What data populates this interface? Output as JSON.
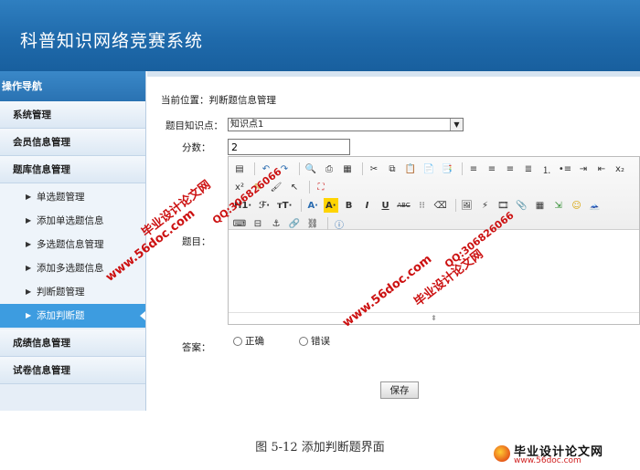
{
  "app": {
    "title": "科普知识网络竞赛系统"
  },
  "sidebar": {
    "header": "操作导航",
    "categories": [
      "系统管理",
      "会员信息管理",
      "题库信息管理"
    ],
    "items": [
      "单选题管理",
      "添加单选题信息",
      "多选题信息管理",
      "添加多选题信息",
      "判断题管理",
      "添加判断题"
    ],
    "active_item": "添加判断题",
    "bottom_categories": [
      "成绩信息管理",
      "试卷信息管理"
    ]
  },
  "main": {
    "breadcrumb": "当前位置：判断题信息管理",
    "fields": {
      "knowledge_label": "题目知识点：",
      "knowledge_value": "知识点1",
      "score_label": "分数：",
      "score_value": "2",
      "question_label": "题目：",
      "answer_label": "答案：",
      "answer_options": [
        "正确",
        "错误"
      ]
    },
    "save_label": "保存"
  },
  "editor": {
    "heading_drop": "H1·",
    "font_drop": "ℱ·",
    "size_drop": "тT·",
    "color_drop": "A·",
    "bg_drop": "A·",
    "bold": "B",
    "italic": "I",
    "underline": "U",
    "strike": "ABC",
    "sub": "x₂",
    "sup": "x²"
  },
  "watermarks": {
    "site": "www.56doc.com",
    "brand": "毕业设计论文网",
    "qq": "QQ:306826066"
  },
  "caption": "图 5-12 添加判断题界面",
  "logo": {
    "name": "毕业设计论文网",
    "url": "www.56doc.com"
  },
  "colors": {
    "header": "#1f6aab",
    "active": "#3d9ce0",
    "watermark": "#cc1111"
  }
}
